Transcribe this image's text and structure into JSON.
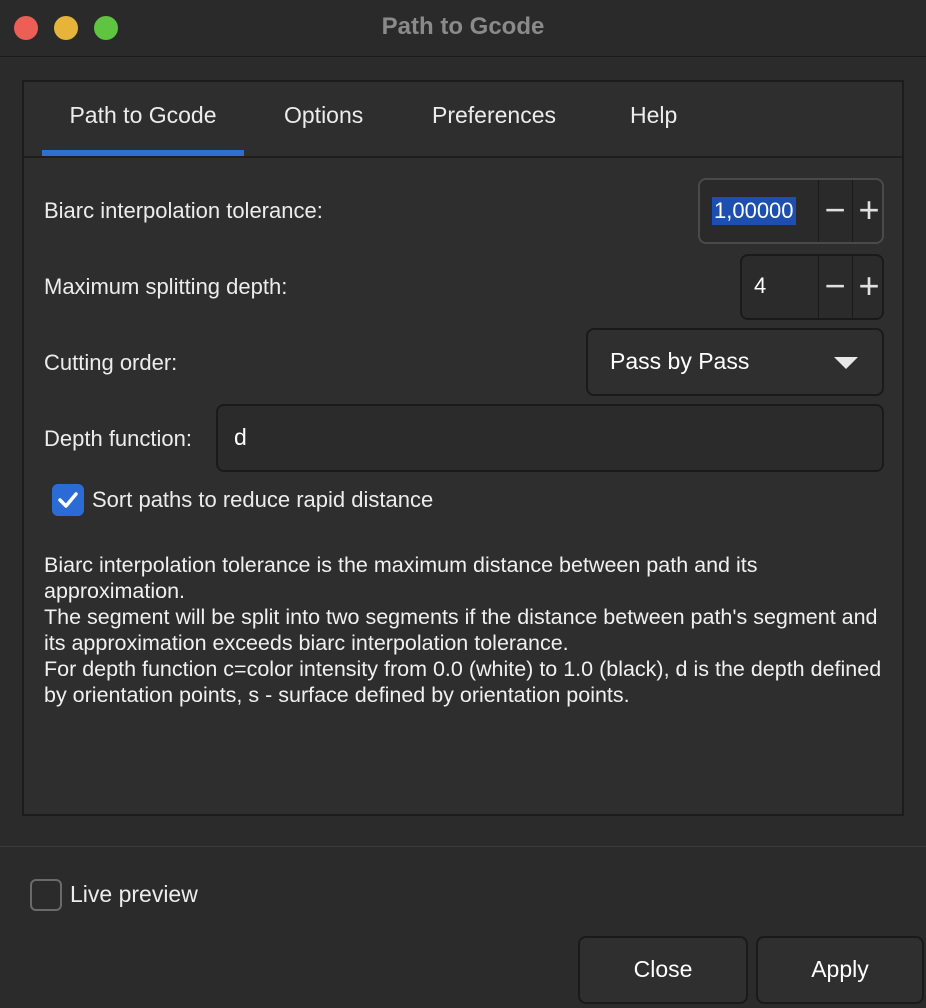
{
  "window": {
    "title": "Path to Gcode"
  },
  "tabs": [
    {
      "label": "Path to Gcode",
      "active": true
    },
    {
      "label": "Options",
      "active": false
    },
    {
      "label": "Preferences",
      "active": false
    },
    {
      "label": "Help",
      "active": false
    }
  ],
  "fields": {
    "biarc_tolerance": {
      "label": "Biarc interpolation tolerance:",
      "value": "1,00000"
    },
    "max_split_depth": {
      "label": "Maximum splitting depth:",
      "value": "4"
    },
    "cutting_order": {
      "label": "Cutting order:",
      "selected": "Pass by Pass"
    },
    "depth_function": {
      "label": "Depth function:",
      "value": "d"
    },
    "sort_paths": {
      "label": "Sort paths to reduce rapid distance",
      "checked": true
    }
  },
  "description": [
    "Biarc interpolation tolerance is the maximum distance between path and its approximation.",
    "The segment will be split into two segments if the distance between path's segment and its approximation exceeds biarc interpolation tolerance.",
    "For depth function c=color intensity from 0.0 (white) to 1.0 (black), d is the depth defined by orientation points, s - surface defined by orientation points."
  ],
  "footer": {
    "live_preview": {
      "label": "Live preview",
      "checked": false
    },
    "close_label": "Close",
    "apply_label": "Apply"
  },
  "colors": {
    "accent": "#2f6fd0",
    "close": "#ec5f57",
    "minimize": "#e7b43b",
    "maximize": "#5fc43f",
    "background": "#2b2b2b"
  }
}
